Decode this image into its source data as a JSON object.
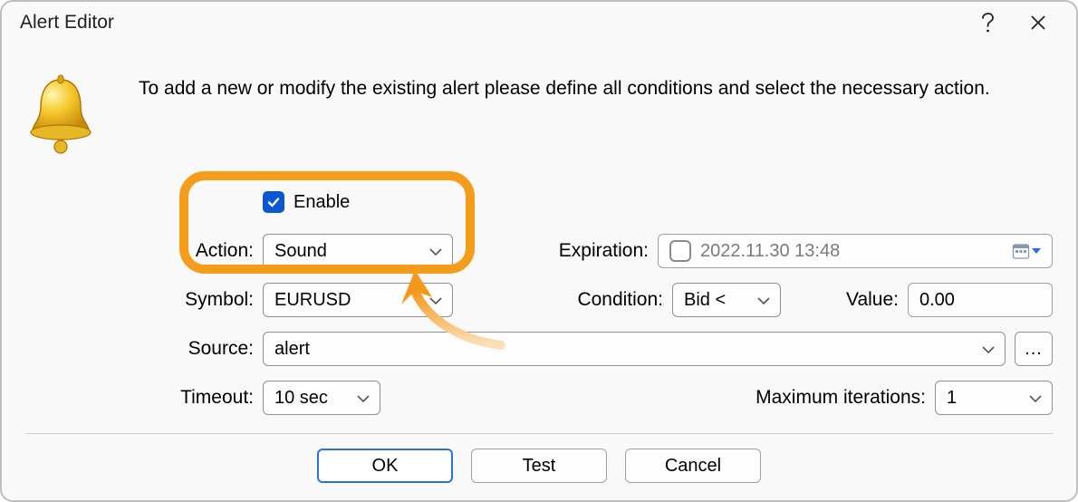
{
  "window": {
    "title": "Alert Editor"
  },
  "description": "To add a new or modify the existing alert please define all conditions and select the necessary action.",
  "labels": {
    "enable": "Enable",
    "action": "Action:",
    "expiration": "Expiration:",
    "symbol": "Symbol:",
    "condition": "Condition:",
    "value": "Value:",
    "source": "Source:",
    "timeout": "Timeout:",
    "max_iterations": "Maximum iterations:"
  },
  "values": {
    "enable_checked": true,
    "action": "Sound",
    "expiration_checked": false,
    "expiration": "2022.11.30 13:48",
    "symbol": "EURUSD",
    "condition": "Bid <",
    "value": "0.00",
    "source": "alert",
    "timeout": "10 sec",
    "max_iterations": "1"
  },
  "buttons": {
    "ok": "OK",
    "test": "Test",
    "cancel": "Cancel",
    "more": "..."
  }
}
